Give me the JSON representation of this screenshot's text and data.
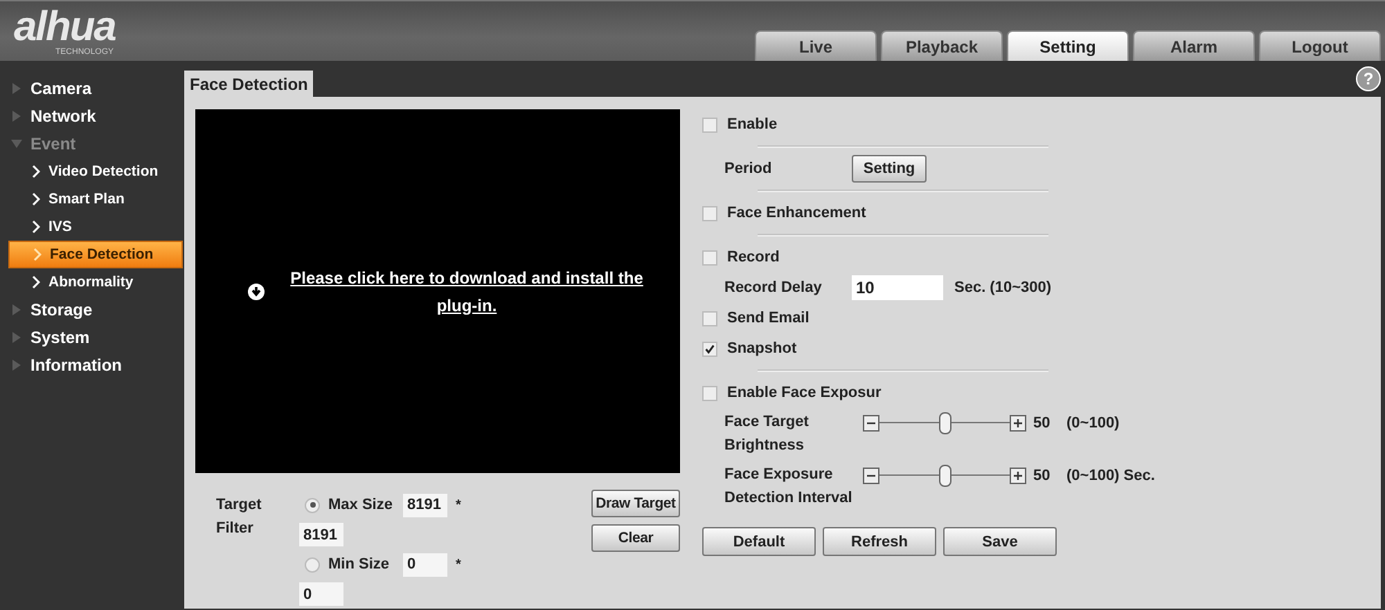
{
  "logo": {
    "wordmark": "alhua",
    "tagline": "TECHNOLOGY"
  },
  "nav_tabs": [
    {
      "label": "Live",
      "selected": false
    },
    {
      "label": "Playback",
      "selected": false
    },
    {
      "label": "Setting",
      "selected": true
    },
    {
      "label": "Alarm",
      "selected": false
    },
    {
      "label": "Logout",
      "selected": false
    }
  ],
  "sidebar": {
    "items": [
      {
        "label": "Camera",
        "expanded": false
      },
      {
        "label": "Network",
        "expanded": false
      },
      {
        "label": "Event",
        "expanded": true,
        "children": [
          {
            "label": "Video Detection",
            "selected": false
          },
          {
            "label": "Smart Plan",
            "selected": false
          },
          {
            "label": "IVS",
            "selected": false
          },
          {
            "label": "Face Detection",
            "selected": true
          },
          {
            "label": "Abnormality",
            "selected": false
          }
        ]
      },
      {
        "label": "Storage",
        "expanded": false
      },
      {
        "label": "System",
        "expanded": false
      },
      {
        "label": "Information",
        "expanded": false
      }
    ]
  },
  "page_tab": {
    "label": "Face Detection",
    "help": "?"
  },
  "video": {
    "link": "Please click here to download and install the plug-in."
  },
  "target_filter": {
    "label": "Target Filter",
    "options": [
      {
        "label": "Max Size",
        "selected": true,
        "value": "8191",
        "note": "*",
        "value_2": "8191"
      },
      {
        "label": "Min Size",
        "selected": false,
        "value": "0",
        "note": "*",
        "value_2": "0"
      }
    ],
    "buttons": [
      "Draw Target",
      "Clear"
    ]
  },
  "settings": [
    {
      "kind": "checkbox",
      "label": "Enable",
      "checked": false
    },
    {
      "kind": "divider"
    },
    {
      "kind": "button",
      "label": "Period",
      "button": "Setting"
    },
    {
      "kind": "divider"
    },
    {
      "kind": "checkbox",
      "label": "Face Enhancement",
      "checked": false
    },
    {
      "kind": "divider"
    },
    {
      "kind": "checkbox",
      "label": "Record",
      "checked": false
    },
    {
      "kind": "input",
      "label": "Record Delay",
      "value": "10",
      "unit": "Sec. (10~300)"
    },
    {
      "kind": "checkbox",
      "label": "Send Email",
      "checked": false
    },
    {
      "kind": "checkbox",
      "label": "Snapshot",
      "checked": true
    },
    {
      "kind": "divider"
    },
    {
      "kind": "checkbox",
      "label": "Enable Face Exposur",
      "checked": false
    },
    {
      "kind": "slider",
      "label": "Face Target Brightness",
      "level": 0.5,
      "value": "50",
      "range": "(0~100)"
    },
    {
      "kind": "slider",
      "label": "Face Exposure Detection Interval",
      "level": 0.5,
      "value": "50",
      "range": "(0~100) Sec."
    }
  ],
  "buttons": [
    "Default",
    "Refresh",
    "Save"
  ]
}
